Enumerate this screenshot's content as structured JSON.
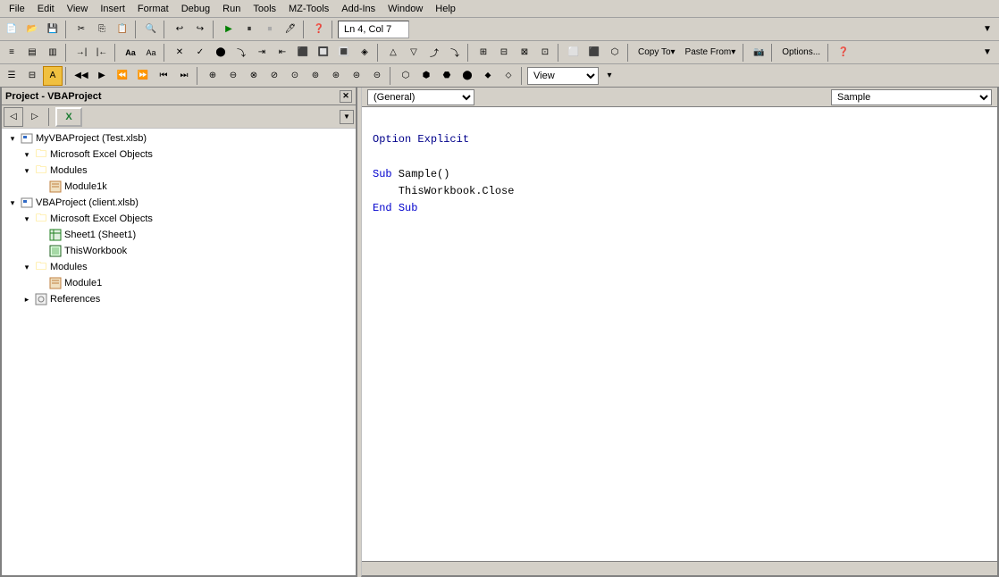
{
  "menubar": {
    "items": [
      "File",
      "Edit",
      "View",
      "Insert",
      "Format",
      "Debug",
      "Run",
      "Tools",
      "MZ-Tools",
      "Add-Ins",
      "Window",
      "Help"
    ]
  },
  "statusbar": {
    "position": "Ln 4, Col 7"
  },
  "toolbar1": {
    "copy_label": "Copy To▾",
    "paste_label": "Paste From▾",
    "options_label": "Options..."
  },
  "view_dropdown": "(General)",
  "procedure_dropdown": "Sample",
  "project_panel": {
    "title": "Project - VBAProject",
    "tree": [
      {
        "id": "myvba",
        "level": 0,
        "expanded": true,
        "label": "MyVBAProject (Test.xlsb)",
        "type": "vbproject"
      },
      {
        "id": "excel-objects1",
        "level": 1,
        "expanded": true,
        "label": "Microsoft Excel Objects",
        "type": "folder"
      },
      {
        "id": "modules1",
        "level": 1,
        "expanded": true,
        "label": "Modules",
        "type": "folder"
      },
      {
        "id": "module1k",
        "level": 2,
        "expanded": false,
        "label": "Module1k",
        "type": "module"
      },
      {
        "id": "vba2",
        "level": 0,
        "expanded": true,
        "label": "VBAProject (client.xlsb)",
        "type": "vbproject"
      },
      {
        "id": "excel-objects2",
        "level": 1,
        "expanded": true,
        "label": "Microsoft Excel Objects",
        "type": "folder"
      },
      {
        "id": "sheet1",
        "level": 2,
        "expanded": false,
        "label": "Sheet1 (Sheet1)",
        "type": "sheet"
      },
      {
        "id": "thisworkbook",
        "level": 2,
        "expanded": false,
        "label": "ThisWorkbook",
        "type": "workbook"
      },
      {
        "id": "modules2",
        "level": 1,
        "expanded": true,
        "label": "Modules",
        "type": "folder"
      },
      {
        "id": "module1",
        "level": 2,
        "expanded": false,
        "label": "Module1",
        "type": "module"
      },
      {
        "id": "references",
        "level": 1,
        "expanded": false,
        "label": "References",
        "type": "ref"
      }
    ]
  },
  "code_editor": {
    "header": "(General)",
    "lines": [
      {
        "type": "blank"
      },
      {
        "type": "code",
        "content": "Option Explicit",
        "style": "blue"
      },
      {
        "type": "blank"
      },
      {
        "type": "code",
        "content": "Sub Sample()",
        "style": "mixed_blue"
      },
      {
        "type": "code",
        "content": "    ThisWorkbook.Close",
        "style": "normal",
        "indent": true
      },
      {
        "type": "code",
        "content": "End Sub",
        "style": "mixed_blue"
      }
    ]
  },
  "icons": {
    "expand": "▸",
    "collapse": "▾",
    "folder": "📁",
    "close": "✕"
  }
}
